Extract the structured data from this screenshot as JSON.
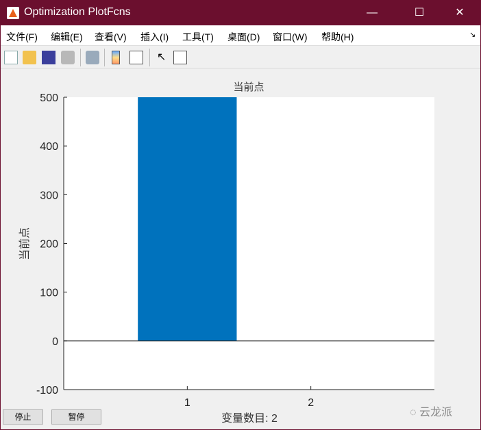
{
  "window": {
    "title": "Optimization PlotFcns",
    "minimize": "—",
    "maximize": "☐",
    "close": "✕"
  },
  "menu": [
    "文件(F)",
    "编辑(E)",
    "查看(V)",
    "插入(I)",
    "工具(T)",
    "桌面(D)",
    "窗口(W)",
    "帮助(H)"
  ],
  "menu_overflow": "↘",
  "toolbar": [
    "new-icon",
    "open-icon",
    "save-icon",
    "print-icon",
    "link-icon",
    "colorbar-icon",
    "legend-icon",
    "pointer-icon",
    "property-editor-icon"
  ],
  "buttons": {
    "stop": "停止",
    "pause": "暂停"
  },
  "watermark": "云龙派",
  "chart_data": {
    "type": "bar",
    "title": "当前点",
    "xlabel": "变量数目: 2",
    "ylabel": "当前点",
    "categories": [
      "1",
      "2"
    ],
    "x": [
      1,
      2
    ],
    "values": [
      500,
      0
    ],
    "xlim": [
      0,
      3
    ],
    "ylim": [
      -100,
      500
    ],
    "yticks": [
      -100,
      0,
      100,
      200,
      300,
      400,
      500
    ],
    "xticks": [
      1,
      2
    ],
    "bar_color": "#0072bd",
    "grid": false
  }
}
